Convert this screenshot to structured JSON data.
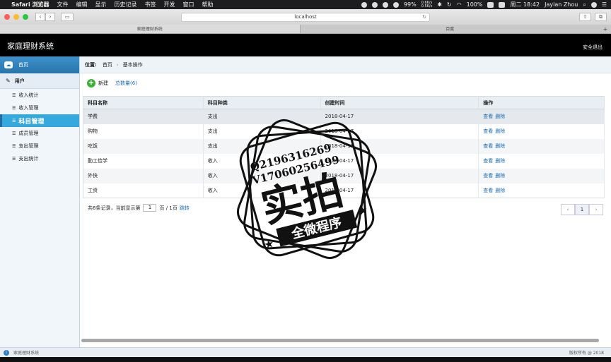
{
  "menubar": {
    "app": "Safari 浏览器",
    "items": [
      "文件",
      "编辑",
      "显示",
      "历史记录",
      "书签",
      "开发",
      "窗口",
      "帮助"
    ],
    "battery_percent": "99%",
    "net_up": "0.6K/s",
    "net_down": "0.5K/s",
    "battery": "100%",
    "clock": "周二 18:42",
    "user": "Jaylan Zhou"
  },
  "browser": {
    "address": "localhost",
    "tabs": [
      "家庭理财系统",
      "百度"
    ]
  },
  "app": {
    "title": "家庭理财系统",
    "logout": "安全退出"
  },
  "sidebar": {
    "home": "首页",
    "group": "用户",
    "items": [
      {
        "label": "收入统计"
      },
      {
        "label": "收入管理"
      },
      {
        "label": "科目管理"
      },
      {
        "label": "成员管理"
      },
      {
        "label": "支出管理"
      },
      {
        "label": "支出统计"
      }
    ]
  },
  "breadcrumb": {
    "prefix": "位置:",
    "home": "首页",
    "sep": "›",
    "current": "基本操作"
  },
  "actions": {
    "new": "新建",
    "total": "总数量(6)"
  },
  "table": {
    "headers": [
      "科目名称",
      "科目种类",
      "创建时间",
      "操作"
    ],
    "rows": [
      {
        "name": "学费",
        "type": "支出",
        "created": "2018-04-17"
      },
      {
        "name": "购物",
        "type": "支出",
        "created": "2018-04-17"
      },
      {
        "name": "吃饭",
        "type": "支出",
        "created": "2018-04-17"
      },
      {
        "name": "勤工俭学",
        "type": "收入",
        "created": "2018-04-17"
      },
      {
        "name": "外快",
        "type": "收入",
        "created": "2018-04-17"
      },
      {
        "name": "工资",
        "type": "收入",
        "created": "2018-04-17"
      }
    ],
    "view": "查看",
    "delete": "删除"
  },
  "pagination": {
    "summary": "共6条记录，当前显示第",
    "page_input": "1",
    "page_of": "页 / 1页",
    "go": "跳转",
    "prev": "‹",
    "current": "1",
    "next": "›"
  },
  "footer": {
    "label": "家庭理财系统",
    "copyright": "版权所有 @ 2018"
  },
  "stamp": {
    "line1": "Q2196316269",
    "line2": "V17060256499",
    "big": "实拍",
    "banner": "全微程序"
  }
}
